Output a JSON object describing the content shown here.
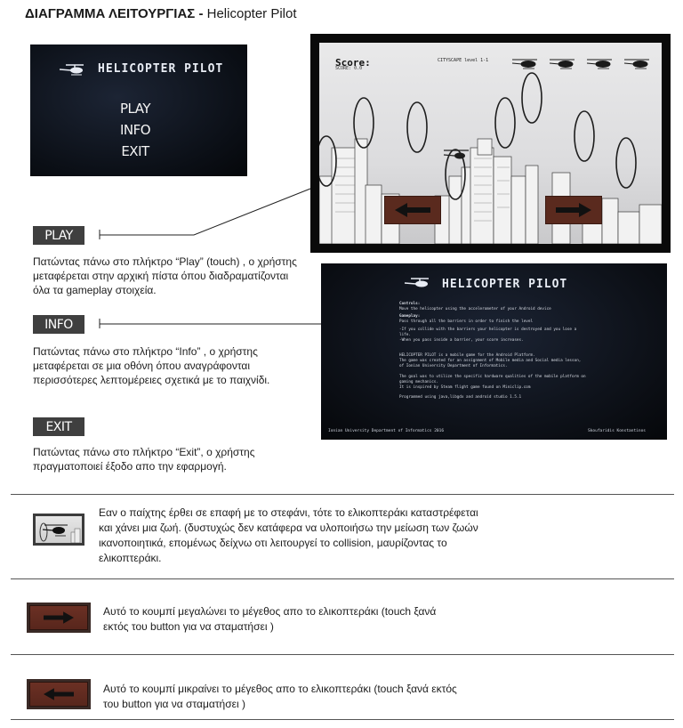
{
  "header": {
    "title_bold": "ΔΙΑΓΡΑΜΜΑ ΛΕΙΤΟΥΡΓΙΑΣ -",
    "title_rest": " Helicopter Pilot"
  },
  "menu_screen": {
    "app_title": "HELICOPTER PILOT",
    "items": [
      "PLAY",
      "INFO",
      "EXIT"
    ],
    "icon": "helicopter-icon"
  },
  "game_screen": {
    "score_label": "Score:",
    "score_sub": "SCORE: 0.0",
    "level_label": "CITYSCAPE level 1-1",
    "lives_icon": "helicopter-icon",
    "lives": 4,
    "left_button_icon": "arrow-left-icon",
    "right_button_icon": "arrow-right-icon"
  },
  "info_screen": {
    "app_title": "HELICOPTER PILOT",
    "lines": [
      "Controls:",
      "Move the helicopter using the accelerometer of your Android device",
      "Gameplay:",
      "Pass through all the barriers in order to finish the level",
      "-If you collide with the barriers your helicopter is destroyed and you lose a",
      "life.",
      "-When you pass inside a barrier, your score increases.",
      "HELICOPTER PILOT is a mobile game for the Android Platform.",
      "The game was created for an assignment of Mobile media and Social media lesson,",
      "of Ionian University Department of Informatics.",
      "The goal was to utilize the specific hardware qualities of the mobile platform on",
      "gaming mechanics.",
      "It is inspired by Steam flight game found on Miniclip.com",
      "Programmed using java,libgdx and android studio 1.5.1"
    ],
    "footer_left": "Ionian University Department of Informatics 2016",
    "footer_right": "Skoufaridis Konstantinos"
  },
  "sections": {
    "play": {
      "tag": "PLAY",
      "text": "Πατώντας πάνω στο πλήκτρο “Play” (touch) , ο χρήστης μεταφέρεται στην αρχική πίστα όπου διαδραματίζονται όλα τα gameplay στοιχεία."
    },
    "info": {
      "tag": "INFO",
      "text": "Πατώντας πάνω στο πλήκτρο “Info” , ο χρήστης μεταφέρεται σε μια οθόνη όπου αναγράφονται περισσότερες λεπτομέρειες σχετικά με το παιχνίδι."
    },
    "exit": {
      "tag": "EXIT",
      "text": "Πατώντας πάνω στο πλήκτρο “Exit”, ο χρήστης πραγματοποιεί έξοδο απο την εφαρμογή."
    }
  },
  "notes": {
    "collision": "Εαν ο παίχτης έρθει σε επαφή με το στεφάνι, τότε το ελικοπτεράκι καταστρέφεται και χάνει μια ζωή. (δυστυχώς δεν κατάφερα να υλοποιήσω την μείωση των ζωών ικανοποιητικά, επομένως δείχνω οτι λειτουργεί το collision, μαυρίζοντας το ελικοπτεράκι.",
    "right_button": "Αυτό το κουμπί μεγαλώνει το μέγεθος απο το ελικοπτεράκι (touch ξανά εκτός του button για να σταματήσει )",
    "left_button": "Αυτό το κουμπί μικραίνει το μέγεθος απο το ελικοπτεράκι (touch ξανά εκτός του button για να σταματήσει )"
  },
  "colors": {
    "tag_bg": "#3f3f3f",
    "arrow_button": "#5a2a1e",
    "dark_screen": "#0b0f16"
  }
}
